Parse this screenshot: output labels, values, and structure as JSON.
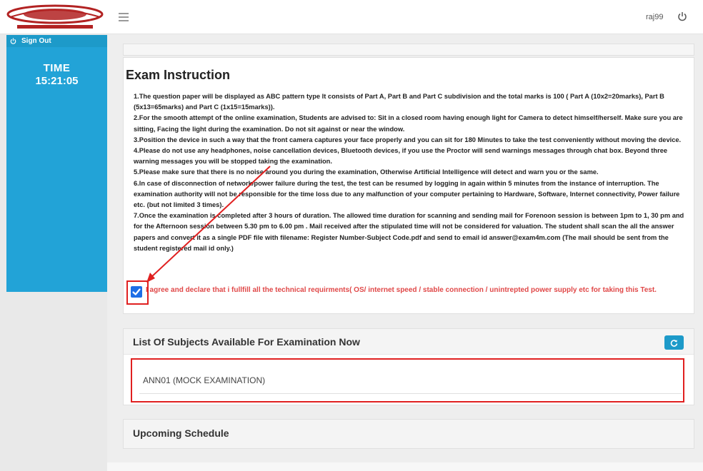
{
  "header": {
    "username": "raj99",
    "menu_icon": "hamburger-icon",
    "power_icon": "power-icon"
  },
  "sidebar": {
    "signout_label": "Sign Out",
    "timer_label": "TIME",
    "timer_value": "15:21:05"
  },
  "instructions": {
    "title": "Exam Instruction",
    "lines": [
      "1.The question paper will be displayed as ABC pattern type It consists of Part A, Part B and Part C subdivision and the total marks is 100 ( Part A (10x2=20marks), Part B (5x13=65marks) and Part C (1x15=15marks)).",
      "2.For the smooth attempt of the online examination, Students are advised to: Sit in a closed room having enough light for Camera to detect himself/herself. Make sure you are sitting, Facing the light during the examination. Do not sit against or near the window.",
      "3.Position the device in such a way that the front camera captures your face properly and you can sit for 180 Minutes to take the test conveniently without moving the device.",
      "4.Please do not use any headphones, noise cancellation devices, Bluetooth devices, if you use the Proctor will send warnings messages through chat box. Beyond three warning messages you will be stopped taking the examination.",
      "5.Please make sure that there is no noise around you during the examination, Otherwise Artificial Intelligence will detect and warn you or the same.",
      "6.In case of disconnection of network/power failure during the test, the test can be resumed by logging in again within 5 minutes from the instance of interruption. The examination authority will not be responsible for the time loss due to any malfunction of your computer pertaining to Hardware, Software, Internet connectivity, Power failure etc. (but not limited 3 times).",
      "7.Once the examination is completed after 3 hours of duration. The allowed time duration for scanning and sending mail for Forenoon session is between 1pm to 1, 30 pm and for the Afternoon session between 5.30 pm to 6.00 pm . Mail received after the stipulated time will not be considered for valuation. The student shall scan the all the answer papers and convert it as a single PDF file with filename: Register Number-Subject Code.pdf and send to email id answer@exam4m.com (The mail should be sent from the student registered mail id only.)"
    ],
    "agree_text": "I agree and declare that i fullfill all the technical requirments( OS/ internet speed / stable connection / unintrepted power supply etc for taking this Test.",
    "agree_checked": true
  },
  "subjects": {
    "title": "List Of Subjects Available For Examination Now",
    "refresh_icon": "refresh-icon",
    "items": [
      "ANN01 (MOCK EXAMINATION)"
    ]
  },
  "upcoming": {
    "title": "Upcoming Schedule"
  },
  "colors": {
    "accent": "#1d9ac9",
    "highlight": "#e02020",
    "agree_text": "#e04848"
  }
}
